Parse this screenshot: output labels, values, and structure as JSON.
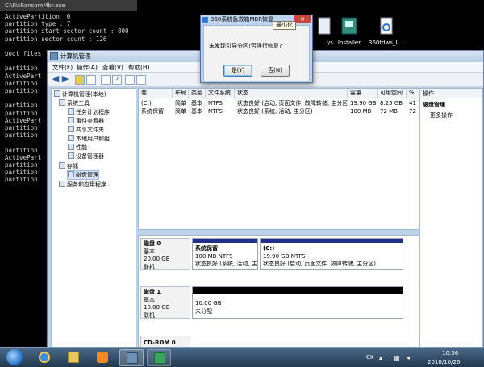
{
  "console": {
    "title": "C:\\FixRansomMbr.exe",
    "lines": [
      "ActivePartition :0",
      "partition type : 7",
      "partition start sector count : 800",
      "partition sector count : 126",
      "",
      "boot files",
      "",
      "partition",
      "ActivePart",
      "partition",
      "partition",
      "",
      "partition",
      "partition",
      "ActivePart",
      "partition",
      "partition",
      "",
      "partition",
      "ActivePart",
      "partition",
      "partition",
      "partition"
    ]
  },
  "desktop": {
    "icons": [
      {
        "label": "ys",
        "icon": "file-icon"
      },
      {
        "label": "Installer",
        "icon": "installer-icon"
      },
      {
        "label": "360tdws_L...",
        "icon": "gear-file-icon"
      }
    ]
  },
  "window": {
    "title": "计算机管理",
    "menu": [
      "文件(F)",
      "操作(A)",
      "查看(V)",
      "帮助(H)"
    ],
    "tree": [
      {
        "label": "计算机管理(本地)",
        "level": 0
      },
      {
        "label": "系统工具",
        "level": 1
      },
      {
        "label": "任务计划程序",
        "level": 2
      },
      {
        "label": "事件查看器",
        "level": 2
      },
      {
        "label": "共享文件夹",
        "level": 2
      },
      {
        "label": "本地用户和组",
        "level": 2
      },
      {
        "label": "性能",
        "level": 2
      },
      {
        "label": "设备管理器",
        "level": 2
      },
      {
        "label": "存储",
        "level": 1
      },
      {
        "label": "磁盘管理",
        "level": 2,
        "selected": true
      },
      {
        "label": "服务和应用程序",
        "level": 1
      }
    ],
    "columns": [
      "卷",
      "布局",
      "类型",
      "文件系统",
      "状态",
      "容量",
      "可用空间",
      "%"
    ],
    "rows": [
      [
        "(C:)",
        "简单",
        "基本",
        "NTFS",
        "状态良好 (启动, 页面文件, 故障转储, 主分区)",
        "19.90 GB",
        "8.25 GB",
        "41"
      ],
      [
        "系统保留",
        "简单",
        "基本",
        "NTFS",
        "状态良好 (系统, 活动, 主分区)",
        "100 MB",
        "72 MB",
        "72"
      ]
    ],
    "disks": [
      {
        "name": "磁盘 0",
        "type": "基本",
        "size": "20.00 GB",
        "status": "联机",
        "partitions": [
          {
            "name": "系统保留",
            "size": "100 MB NTFS",
            "status": "状态良好 (系统, 活动, 主"
          },
          {
            "name": "(C:)",
            "size": "19.90 GB NTFS",
            "status": "状态良好 (启动, 页面文件, 故障转储, 主分区)"
          }
        ]
      },
      {
        "name": "磁盘 1",
        "type": "基本",
        "size": "10.00 GB",
        "status": "联机",
        "partitions": [
          {
            "name": "",
            "size": "10.00 GB",
            "status": "未分配"
          }
        ]
      },
      {
        "name": "CD-ROM 0"
      }
    ],
    "actions": {
      "header": "操作",
      "section": "磁盘管理",
      "more": "更多操作"
    }
  },
  "dialog": {
    "title": "360系统急救箱MBR恢复",
    "close": "✕",
    "message": "未发现引导分区!否强行修复?",
    "yes": "是(Y)",
    "no": "否(N)",
    "tooltip": "最小化"
  },
  "taskbar": {
    "lang": "CK",
    "time": "10:36",
    "date": "2018/10/26"
  },
  "colors": {
    "primary_partition_bar": "#1f2f8c",
    "unallocated_bar": "#000000",
    "taskbar": "#2c4560"
  }
}
